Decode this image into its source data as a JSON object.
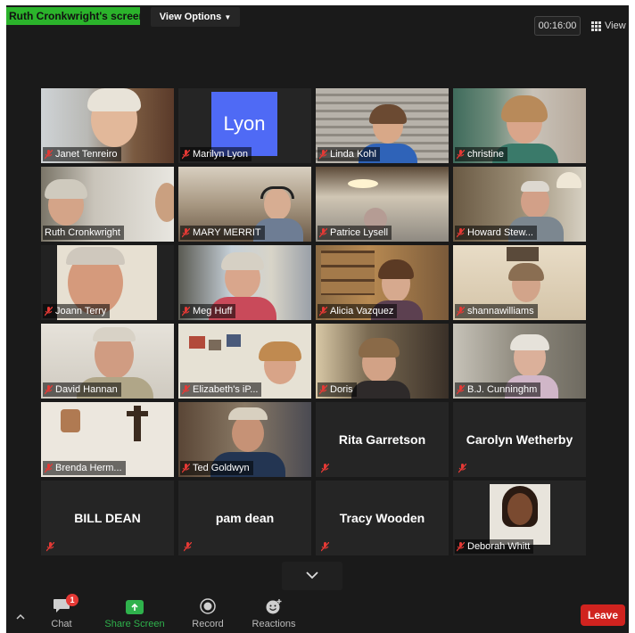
{
  "topbar": {
    "screen_owner_label": "Ruth Cronkwright's screen",
    "view_options_label": "View Options",
    "timer": "00:16:00",
    "view_label": "View"
  },
  "tiles": [
    {
      "name": "Janet Tenreiro"
    },
    {
      "name": "Marilyn Lyon",
      "logo_text": "Lyon"
    },
    {
      "name": "Linda Kohl"
    },
    {
      "name": "christine"
    },
    {
      "name": "Ruth Cronkwright",
      "active_speaker": true
    },
    {
      "name": "MARY MERRIT"
    },
    {
      "name": "Patrice Lysell"
    },
    {
      "name": "Howard Stew..."
    },
    {
      "name": "Joann Terry"
    },
    {
      "name": "Meg Huff"
    },
    {
      "name": "Alicia Vazquez"
    },
    {
      "name": "shannawilliams"
    },
    {
      "name": "David Hannan"
    },
    {
      "name": "Elizabeth's iP..."
    },
    {
      "name": "Doris"
    },
    {
      "name": "B.J. Cunninghm"
    },
    {
      "name": "Brenda Herm..."
    },
    {
      "name": "Ted Goldwyn"
    },
    {
      "name": "Rita Garretson",
      "video_off": true
    },
    {
      "name": "Carolyn Wetherby",
      "video_off": true
    },
    {
      "name": "BILL DEAN",
      "video_off": true
    },
    {
      "name": "pam dean",
      "video_off": true
    },
    {
      "name": "Tracy Wooden",
      "video_off": true
    },
    {
      "name": "Deborah Whitt",
      "profile_photo": true
    }
  ],
  "toolbar": {
    "chat_label": "Chat",
    "chat_badge": "1",
    "share_label": "Share Screen",
    "record_label": "Record",
    "reactions_label": "Reactions",
    "leave_label": "Leave"
  },
  "colors": {
    "share_badge": "#2bb32b",
    "active_speaker_border": "#e6e58a",
    "leave": "#d0231f",
    "share_icon": "#2fb24c",
    "lyon_logo": "#4f6af5"
  }
}
